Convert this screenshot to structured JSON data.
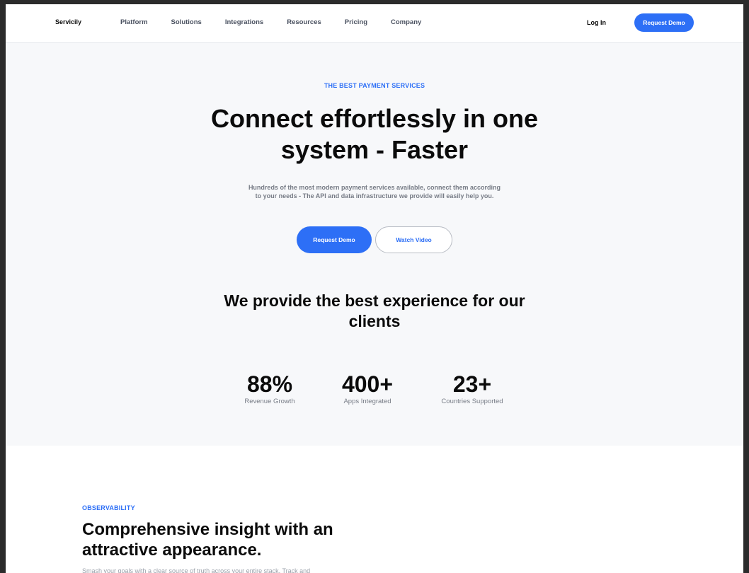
{
  "nav": {
    "brand": "Servicily",
    "links": [
      "Platform",
      "Solutions",
      "Integrations",
      "Resources",
      "Pricing",
      "Company"
    ],
    "login_label": "Log In",
    "demo_label": "Request Demo"
  },
  "hero": {
    "eyebrow": "THE BEST PAYMENT SERVICES",
    "title": "Connect effortlessly in one system - Faster",
    "subtitle": "Hundreds of the most modern payment services available, connect them according to your needs - The API and data infrastructure we provide will easily help you.",
    "primary_cta": "Request Demo",
    "secondary_cta": "Watch Video"
  },
  "experience": {
    "title": "We provide the best experience for our clients",
    "stats": [
      {
        "value": "88%",
        "label": "Revenue Growth"
      },
      {
        "value": "400+",
        "label": "Apps Integrated"
      },
      {
        "value": "23+",
        "label": "Countries Supported"
      }
    ]
  },
  "observability": {
    "eyebrow": "OBSERVABILITY",
    "title": "Comprehensive insight with an attractive appearance.",
    "description": "Smash your goals with a clear source of truth across your entire stack. Track and"
  },
  "colors": {
    "accent": "#2d6ff6",
    "hero_bg": "#f7f8fa",
    "text_dark": "#0b0b0b",
    "text_muted": "#777c86"
  }
}
